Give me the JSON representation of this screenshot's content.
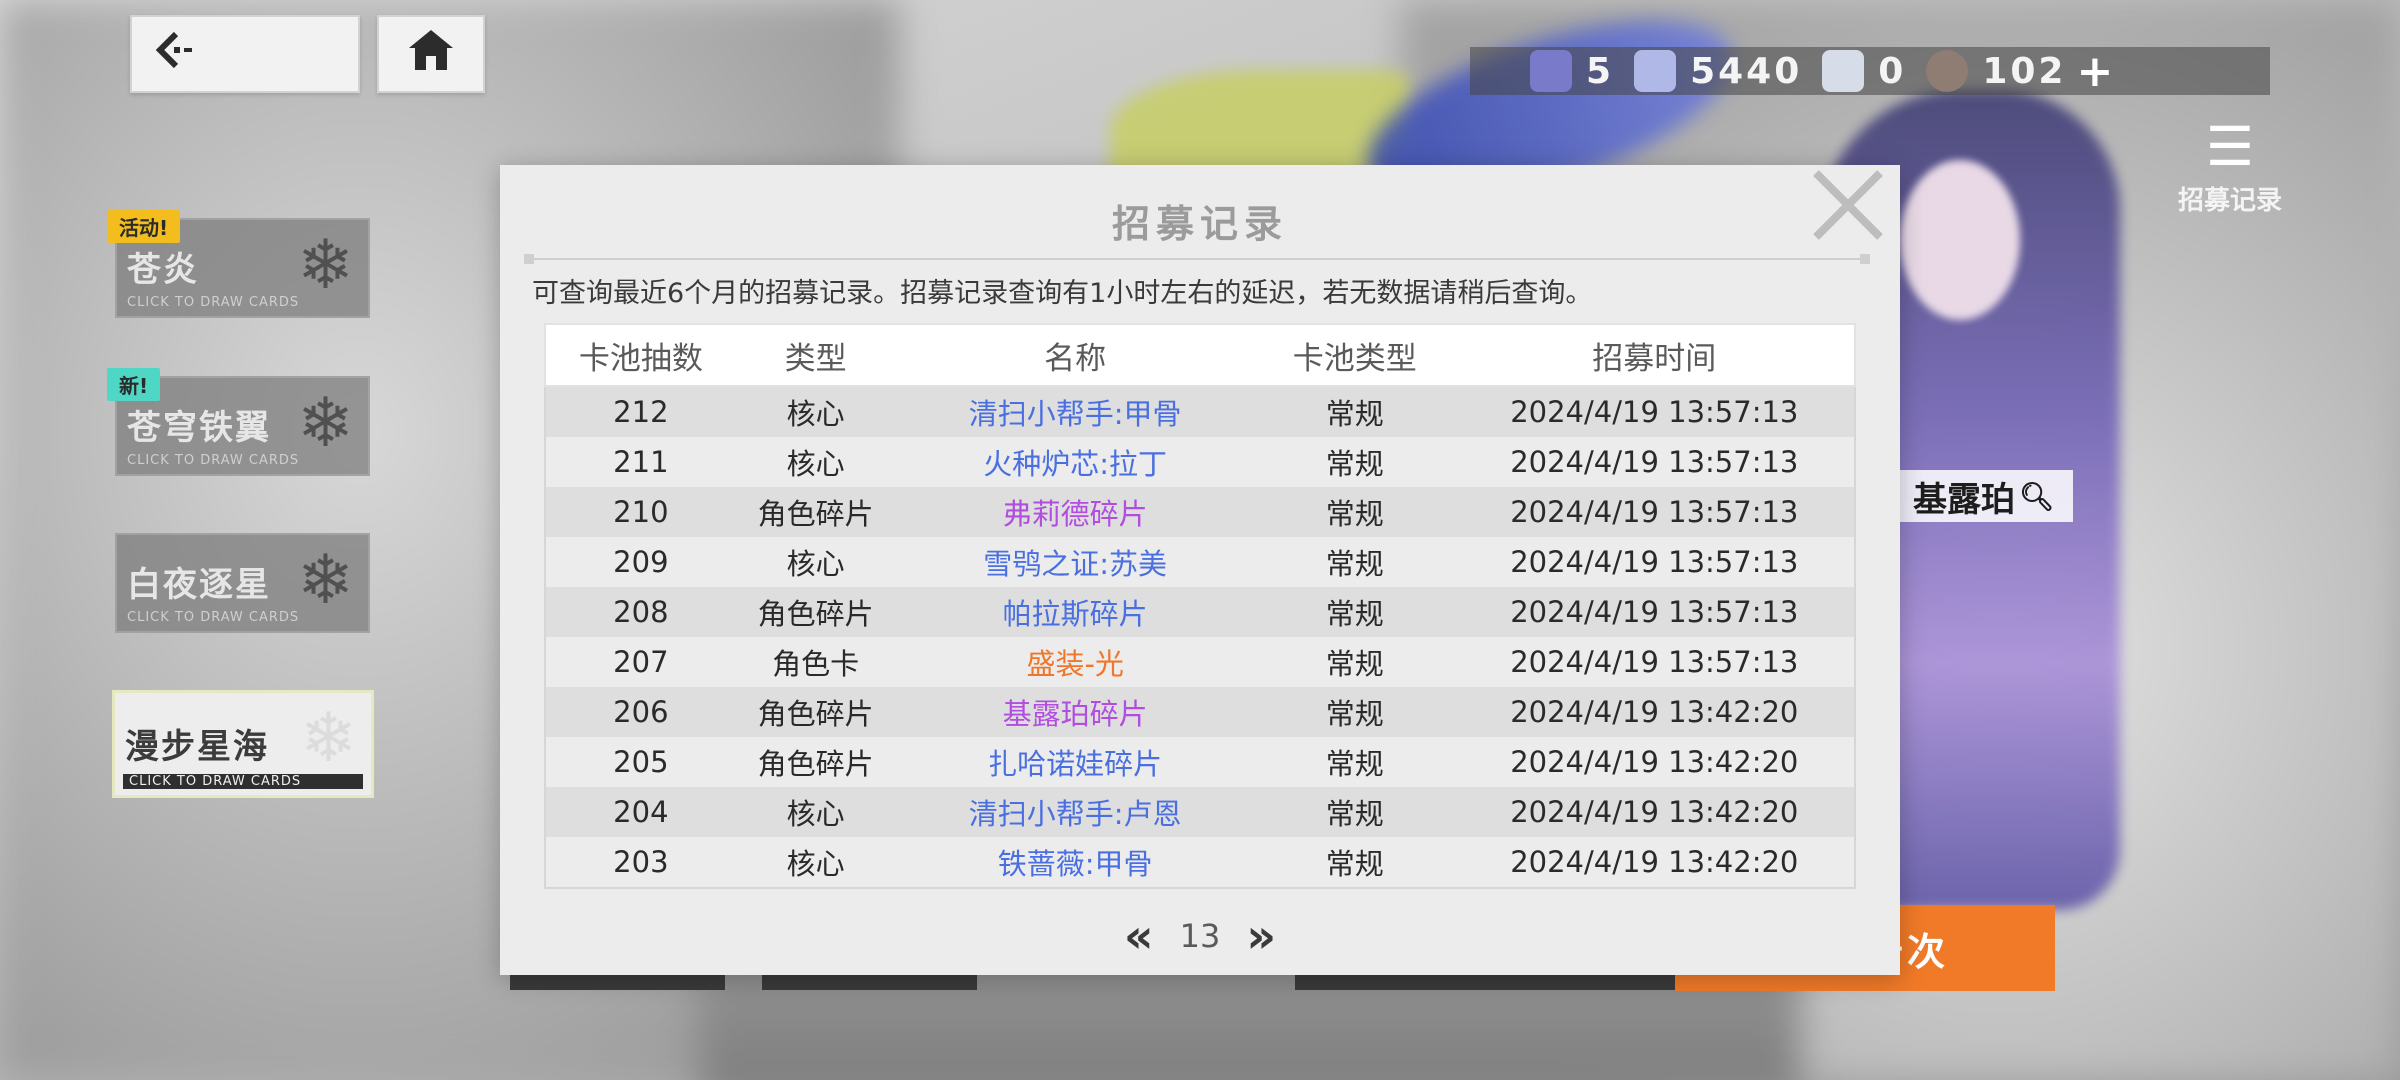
{
  "header": {
    "back_icon": "back-arrow-icon",
    "home_icon": "home-icon"
  },
  "currencies": [
    {
      "icon": "gem-icon",
      "value": "5",
      "color": "#7a7acb"
    },
    {
      "icon": "crystal-icon",
      "value": "5440",
      "color": "#b0b8e8"
    },
    {
      "icon": "ticket-icon",
      "value": "0",
      "color": "#d6dde8"
    },
    {
      "icon": "stamina-icon",
      "value": "102",
      "color": "#8f7c72"
    }
  ],
  "record_shortcut": {
    "label": "招募记录"
  },
  "banners": [
    {
      "name": "苍炎",
      "badge": "活动!",
      "sub": "CLICK TO DRAW CARDS"
    },
    {
      "name": "苍穹铁翼",
      "badge": "新!",
      "sub": "CLICK TO DRAW CARDS"
    },
    {
      "name": "白夜逐星",
      "badge": "",
      "sub": "CLICK TO DRAW CARDS"
    },
    {
      "name": "漫步星海",
      "badge": "",
      "sub": "CLICK TO DRAW CARDS"
    }
  ],
  "character_name": "基露珀",
  "recruit_ten_label": "招募十次",
  "modal": {
    "title": "招募记录",
    "notice": "可查询最近6个月的招募记录。招募记录查询有1小时左右的延迟，若无数据请稍后查询。",
    "columns": [
      "卡池抽数",
      "类型",
      "名称",
      "卡池类型",
      "招募时间"
    ],
    "rows": [
      {
        "count": "212",
        "type": "核心",
        "name": "清扫小帮手:甲骨",
        "pool": "常规",
        "time": "2024/4/19 13:57:13",
        "rarity": "blue"
      },
      {
        "count": "211",
        "type": "核心",
        "name": "火种炉芯:拉丁",
        "pool": "常规",
        "time": "2024/4/19 13:57:13",
        "rarity": "blue"
      },
      {
        "count": "210",
        "type": "角色碎片",
        "name": "弗莉德碎片",
        "pool": "常规",
        "time": "2024/4/19 13:57:13",
        "rarity": "purple"
      },
      {
        "count": "209",
        "type": "核心",
        "name": "雪鸮之证:苏美",
        "pool": "常规",
        "time": "2024/4/19 13:57:13",
        "rarity": "blue"
      },
      {
        "count": "208",
        "type": "角色碎片",
        "name": "帕拉斯碎片",
        "pool": "常规",
        "time": "2024/4/19 13:57:13",
        "rarity": "blue"
      },
      {
        "count": "207",
        "type": "角色卡",
        "name": "盛装-光",
        "pool": "常规",
        "time": "2024/4/19 13:57:13",
        "rarity": "orange"
      },
      {
        "count": "206",
        "type": "角色碎片",
        "name": "基露珀碎片",
        "pool": "常规",
        "time": "2024/4/19 13:42:20",
        "rarity": "purple"
      },
      {
        "count": "205",
        "type": "角色碎片",
        "name": "扎哈诺娃碎片",
        "pool": "常规",
        "time": "2024/4/19 13:42:20",
        "rarity": "blue"
      },
      {
        "count": "204",
        "type": "核心",
        "name": "清扫小帮手:卢恩",
        "pool": "常规",
        "time": "2024/4/19 13:42:20",
        "rarity": "blue"
      },
      {
        "count": "203",
        "type": "核心",
        "name": "铁蔷薇:甲骨",
        "pool": "常规",
        "time": "2024/4/19 13:42:20",
        "rarity": "blue"
      }
    ],
    "pager": {
      "prev": "«",
      "page": "13",
      "next": "»"
    }
  },
  "colors": {
    "blue": "#4a6fe0",
    "purple": "#b14de0",
    "orange": "#f0762b",
    "recruit_button": "#f07a28"
  }
}
